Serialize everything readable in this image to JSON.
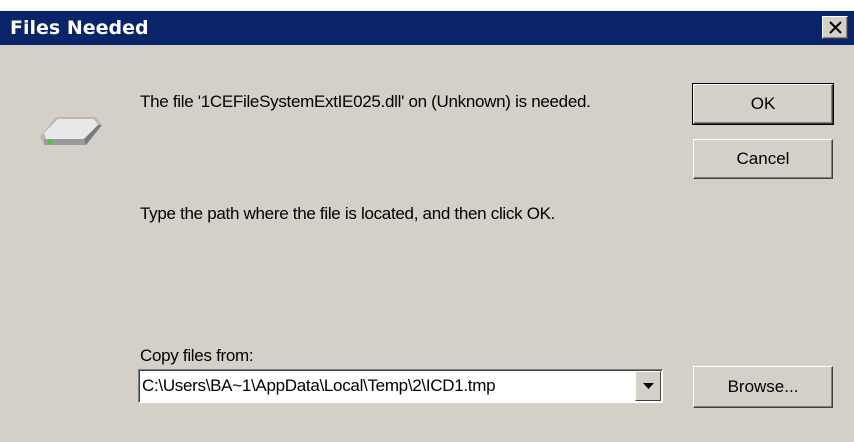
{
  "window": {
    "title": "Files Needed"
  },
  "message": {
    "line1": "The file '1CEFileSystemExtIE025.dll' on (Unknown) is needed.",
    "line2": "Type the path where the file is located, and then click OK."
  },
  "copy_from": {
    "label": "Copy files from:",
    "value": "C:\\Users\\BA~1\\AppData\\Local\\Temp\\2\\ICD1.tmp"
  },
  "buttons": {
    "ok": "OK",
    "cancel": "Cancel",
    "browse": "Browse..."
  },
  "icons": {
    "drive": "drive-icon",
    "close": "close-icon",
    "dropdown": "chevron-down-icon"
  },
  "colors": {
    "titlebar": "#0a246a",
    "dialog_bg": "#d4d0c8"
  }
}
